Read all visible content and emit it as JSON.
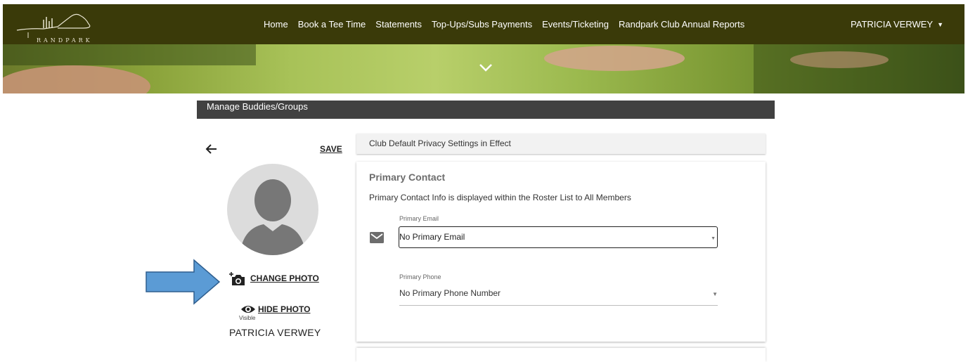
{
  "brand": {
    "logo_text": "RANDPARK"
  },
  "nav": {
    "items": [
      {
        "label": "Home"
      },
      {
        "label": "Book a Tee Time"
      },
      {
        "label": "Statements"
      },
      {
        "label": "Top-Ups/Subs Payments"
      },
      {
        "label": "Events/Ticketing"
      },
      {
        "label": "Randpark Club Annual Reports"
      }
    ],
    "user_name": "PATRICIA VERWEY",
    "user_caret_icon": "caret-down-icon"
  },
  "banner": {
    "expand_icon": "chevron-down-icon"
  },
  "section": {
    "title": "Manage Buddies/Groups"
  },
  "profile": {
    "back_icon": "arrow-left-icon",
    "save_label": "SAVE",
    "avatar_icon": "person-silhouette-icon",
    "change_photo_label": "CHANGE PHOTO",
    "change_photo_icon": "add-camera-icon",
    "hide_photo_label": "HIDE PHOTO",
    "hide_photo_icon": "eye-icon",
    "visibility_status": "Visible",
    "name": "PATRICIA VERWEY"
  },
  "annotation": {
    "pointer_icon": "blue-arrow-right-icon",
    "color": "#5b9bd5"
  },
  "privacy": {
    "notice": "Club Default Privacy Settings in Effect"
  },
  "primary_contact": {
    "title": "Primary Contact",
    "description": "Primary Contact Info is displayed within the Roster List to All Members",
    "email_label": "Primary Email",
    "email_value": "No Primary Email",
    "email_icon": "mail-icon",
    "phone_label": "Primary Phone",
    "phone_value": "No Primary Phone Number"
  },
  "colors": {
    "nav_bg": "#3a3a09",
    "section_bar_bg": "#414141"
  }
}
